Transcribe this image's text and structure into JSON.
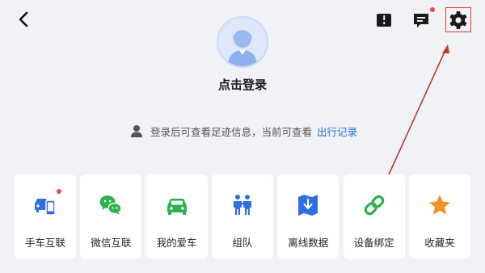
{
  "header": {
    "back_icon": "chevron-left-icon",
    "icons": [
      "bookmark-icon",
      "message-icon",
      "gear-icon"
    ]
  },
  "profile": {
    "avatar_icon": "default-avatar-icon",
    "login_label": "点击登录"
  },
  "notice": {
    "icon": "user-icon",
    "text": "登录后可查看足迹信息，当前可查看",
    "link_label": "出行记录"
  },
  "features": [
    {
      "label": "手车互联",
      "icon": "car-phone-icon",
      "color": "#2f6fe0",
      "badge": true
    },
    {
      "label": "微信互联",
      "icon": "wechat-icon",
      "color": "#2bb24c"
    },
    {
      "label": "我的爱车",
      "icon": "car-icon",
      "color": "#2bb24c"
    },
    {
      "label": "组队",
      "icon": "team-icon",
      "color": "#2f6fe0"
    },
    {
      "label": "离线数据",
      "icon": "offline-map-icon",
      "color": "#2f6fe0"
    },
    {
      "label": "设备绑定",
      "icon": "link-icon",
      "color": "#2bb24c"
    },
    {
      "label": "收藏夹",
      "icon": "star-icon",
      "color": "#f0912a"
    }
  ],
  "colors": {
    "accent": "#1b6fe0",
    "badge": "#f04848",
    "annotation": "#e23a2f"
  }
}
